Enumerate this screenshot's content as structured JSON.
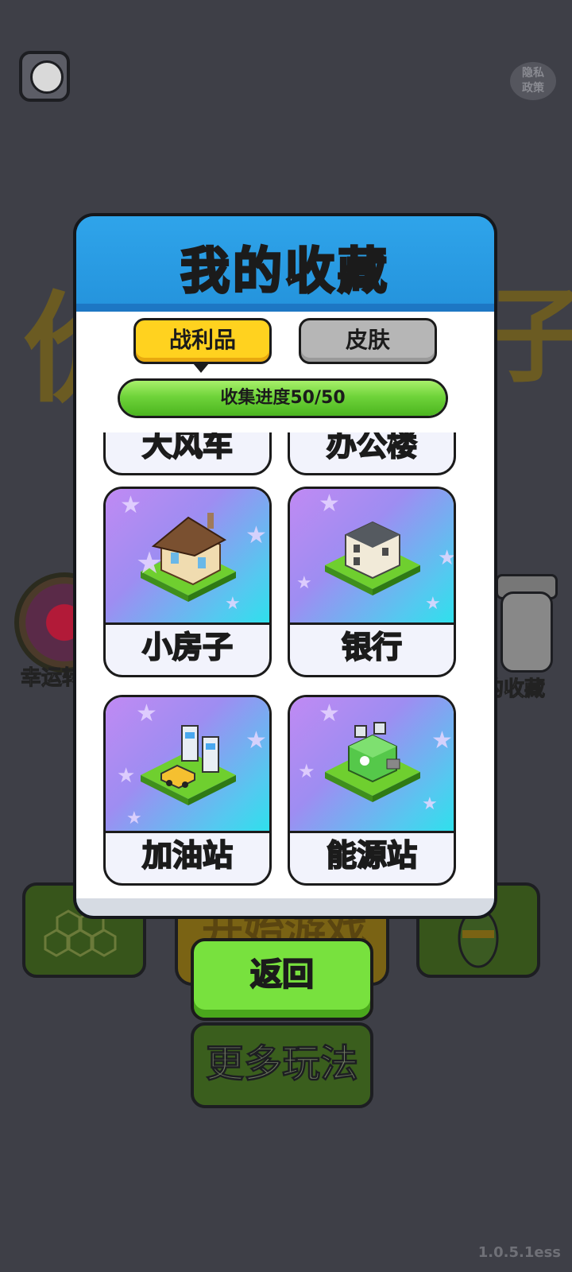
{
  "background": {
    "privacy_label": "隐私\n政策",
    "title_fragment_left": "价",
    "title_fragment_right": "子",
    "lucky_wheel_label": "幸运转",
    "my_collection_label": "的收藏",
    "start_game_label": "开始游戏",
    "more_modes_label": "更多玩法",
    "version": "1.0.5.1ess"
  },
  "modal": {
    "title": "我的收藏",
    "tabs": [
      {
        "label": "战利品",
        "selected": true
      },
      {
        "label": "皮肤",
        "selected": false
      }
    ],
    "progress": {
      "text": "收集进度50/50",
      "value": 50,
      "max": 50
    },
    "items": [
      {
        "label": "大风车",
        "icon": "windmill-icon"
      },
      {
        "label": "办公楼",
        "icon": "office-building-icon"
      },
      {
        "label": "小房子",
        "icon": "small-house-icon"
      },
      {
        "label": "银行",
        "icon": "bank-icon"
      },
      {
        "label": "加油站",
        "icon": "gas-station-icon"
      },
      {
        "label": "能源站",
        "icon": "energy-station-icon"
      }
    ]
  },
  "back_button": {
    "label": "返回"
  },
  "colors": {
    "accent_blue": "#2fa4ea",
    "tab_selected": "#ffd21f",
    "tab_unselected": "#b6b6b6",
    "progress_green": "#6fd33a",
    "back_green": "#78e13e"
  }
}
